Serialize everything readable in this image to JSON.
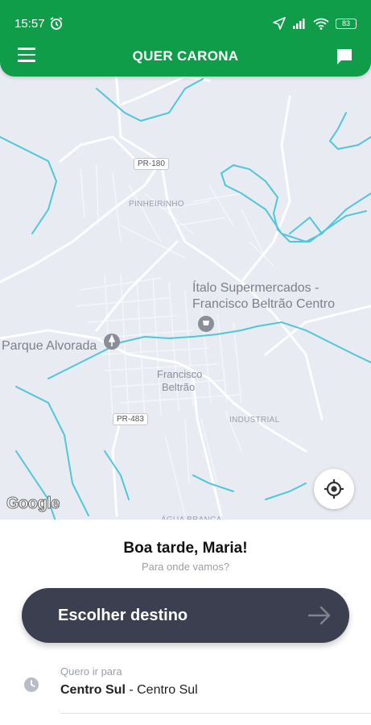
{
  "status_bar": {
    "time": "15:57",
    "battery": "83"
  },
  "header": {
    "title": "QUER CARONA"
  },
  "map": {
    "poi_store_line1": "Ítalo Supermercados -",
    "poi_store_line2": "Francisco Beltrão Centro",
    "poi_park": "Parque Alvorada",
    "city_line1": "Francisco",
    "city_line2": "Beltrão",
    "area_pinheirinho": "PINHEIRINHO",
    "area_industrial": "INDUSTRIAL",
    "area_agua_branca": "ÁGUA BRANCA",
    "route_pr180": "PR-180",
    "route_pr483": "PR-483",
    "attribution": "Google"
  },
  "sheet": {
    "greeting": "Boa tarde, Maria!",
    "subtitle": "Para onde vamos?",
    "destination_button": "Escolher destino",
    "recent_caption": "Quero ir para",
    "recent_name": "Centro Sul",
    "recent_separator": " - ",
    "recent_area": "Centro Sul"
  },
  "colors": {
    "brand_green": "#0f9d4a",
    "button_dark": "#3b3f50",
    "map_bg": "#e9ebf3",
    "river": "#4fc7d8"
  }
}
